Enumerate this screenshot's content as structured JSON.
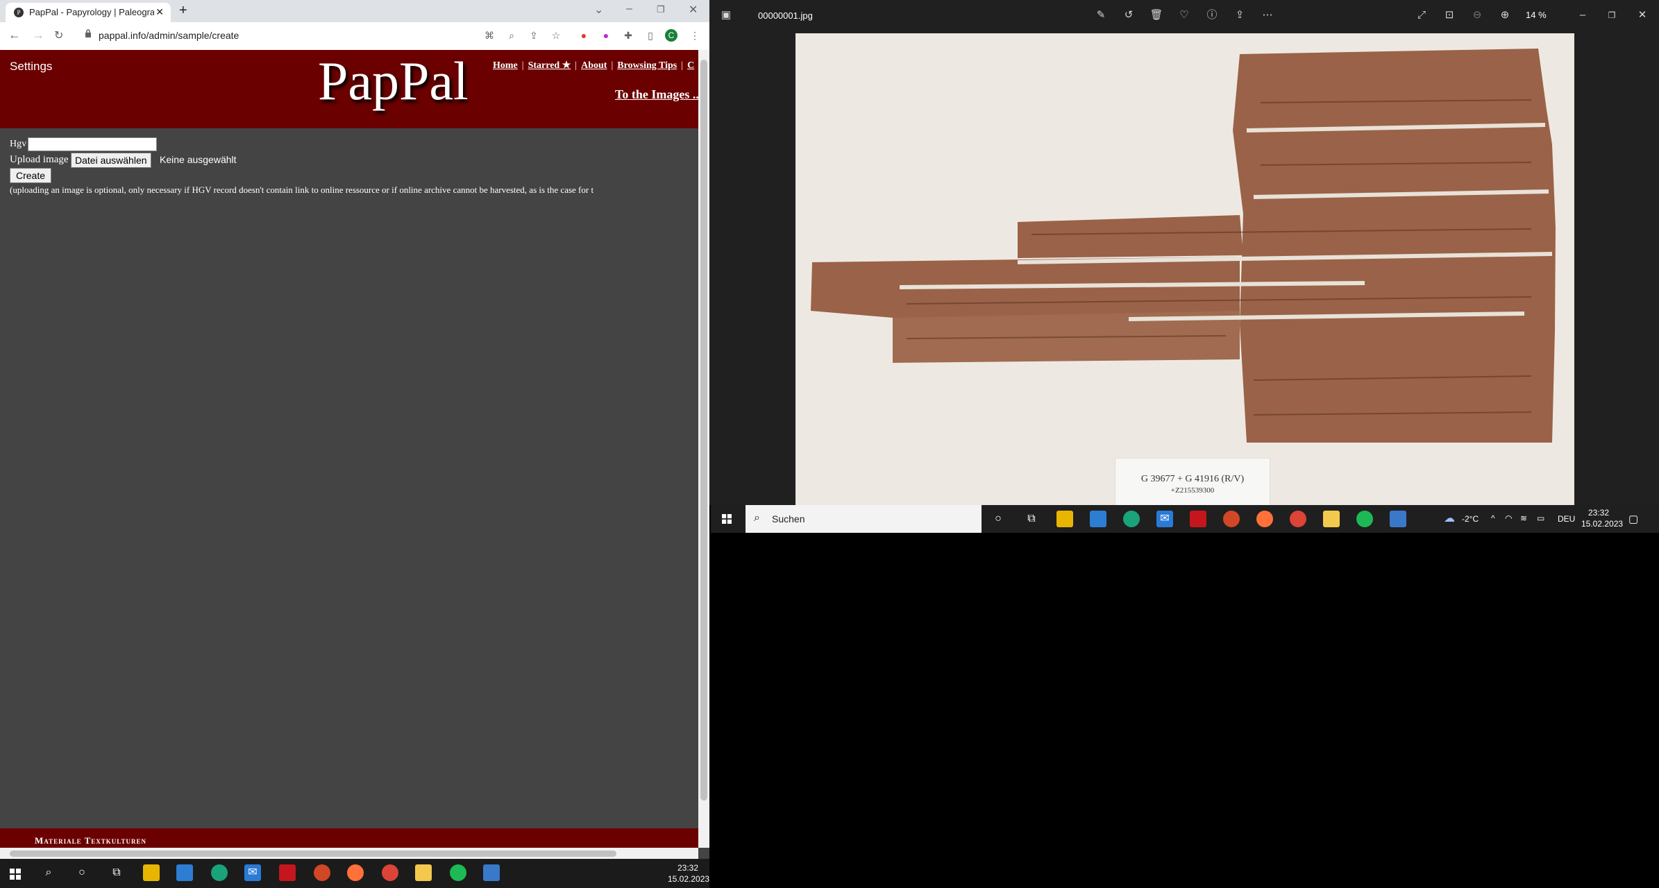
{
  "browser": {
    "tab_title": "PapPal - Papyrology | Paleograph",
    "new_tab": "+",
    "url": "pappal.info/admin/sample/create",
    "profile_letter": "C"
  },
  "page": {
    "settings": "Settings",
    "logo": "PapPal",
    "nav": [
      "Home",
      "Starred ★",
      "About",
      "Browsing Tips",
      "C"
    ],
    "to_images": "To the Images ...",
    "hgv_label": "Hgv",
    "hgv_value": "",
    "upload_label": "Upload image",
    "file_button": "Datei auswählen",
    "no_file": "Keine ausgewählt",
    "create_button": "Create",
    "note": "(uploading an image is optional, only necessary if HGV record doesn't contain link to online ressource or if online archive cannot be harvested, as is the case for t",
    "footer": "Materiale Textkulturen"
  },
  "photos": {
    "filename": "00000001.jpg",
    "zoom": "14 %",
    "label_line1": "G 39677 + G 41916 (R/V)",
    "label_line2": "+Z215539300"
  },
  "taskbar2": {
    "search": "Suchen",
    "weather": "-2°C",
    "lang": "DEU",
    "time": "23:32",
    "date": "15.02.2023"
  },
  "taskbar": {
    "time": "23:32",
    "date": "15.02.2023"
  },
  "colors": {
    "header_red": "#6b0000",
    "page_bg": "#444444",
    "papyrus": "#9a6248"
  }
}
